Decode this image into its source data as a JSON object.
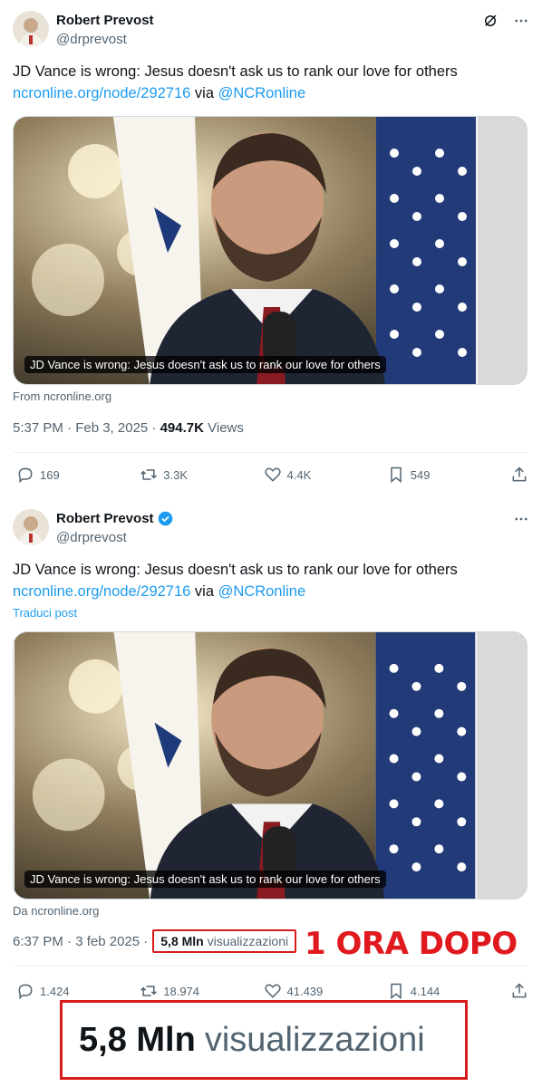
{
  "tweet1": {
    "author_name": "Robert Prevost",
    "handle": "@drprevost",
    "text": "JD Vance is wrong: Jesus doesn't ask us to rank our love for others",
    "link": "ncronline.org/node/292716",
    "via": "via",
    "mention": "@NCRonline",
    "card_caption": "JD Vance is wrong: Jesus doesn't ask us to rank our love for others",
    "source": "From ncronline.org",
    "time": "5:37 PM · Feb 3, 2025 ·",
    "views_count": "494.7K",
    "views_label": "Views",
    "replies": "169",
    "reposts": "3.3K",
    "likes": "4.4K",
    "bookmarks": "549"
  },
  "tweet2": {
    "author_name": "Robert Prevost",
    "handle": "@drprevost",
    "text": "JD Vance is wrong: Jesus doesn't ask us to rank our love for others",
    "link": "ncronline.org/node/292716",
    "via": "via",
    "mention": "@NCRonline",
    "translate": "Traduci post",
    "card_caption": "JD Vance is wrong: Jesus doesn't ask us to rank our love for others",
    "source": "Da ncronline.org",
    "time": "6:37 PM · 3 feb 2025 ·",
    "views_count": "5,8 Mln",
    "views_label": "visualizzazioni",
    "replies": "1.424",
    "reposts": "18.974",
    "likes": "41.439",
    "bookmarks": "4.144"
  },
  "annotation": {
    "label": "1 ORA DOPO",
    "zoom_count": "5,8 Mln",
    "zoom_label": "visualizzazioni"
  },
  "colors": {
    "link": "#1d9bf0",
    "secondary_text": "#536471",
    "highlight_red": "#d81b1b",
    "verified": "#1d9bf0"
  }
}
